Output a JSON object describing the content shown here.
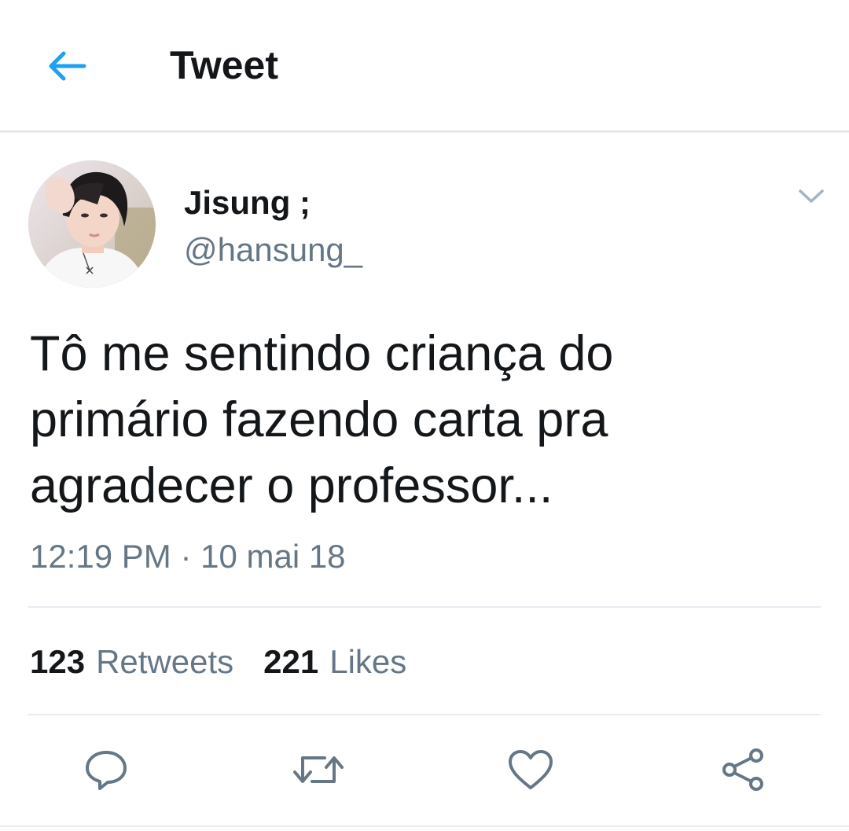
{
  "header": {
    "title": "Tweet",
    "back_icon": "back-arrow-icon"
  },
  "tweet": {
    "author": {
      "display_name": "Jisung ;",
      "handle": "@hansung_"
    },
    "text": "Tô me sentindo criança do\nprimário fazendo carta pra\nagradecer o professor...",
    "timestamp": "12:19 PM · 10 mai 18",
    "stats": {
      "retweets_count": "123",
      "retweets_label": "Retweets",
      "likes_count": "221",
      "likes_label": "Likes"
    },
    "actions": [
      {
        "name": "reply",
        "icon": "reply-icon"
      },
      {
        "name": "retweet",
        "icon": "retweet-icon"
      },
      {
        "name": "like",
        "icon": "heart-icon"
      },
      {
        "name": "share",
        "icon": "share-icon"
      }
    ]
  },
  "colors": {
    "accent": "#1da1f2",
    "text_primary": "#14171a",
    "text_secondary": "#657786",
    "divider": "#e6ecf0"
  }
}
